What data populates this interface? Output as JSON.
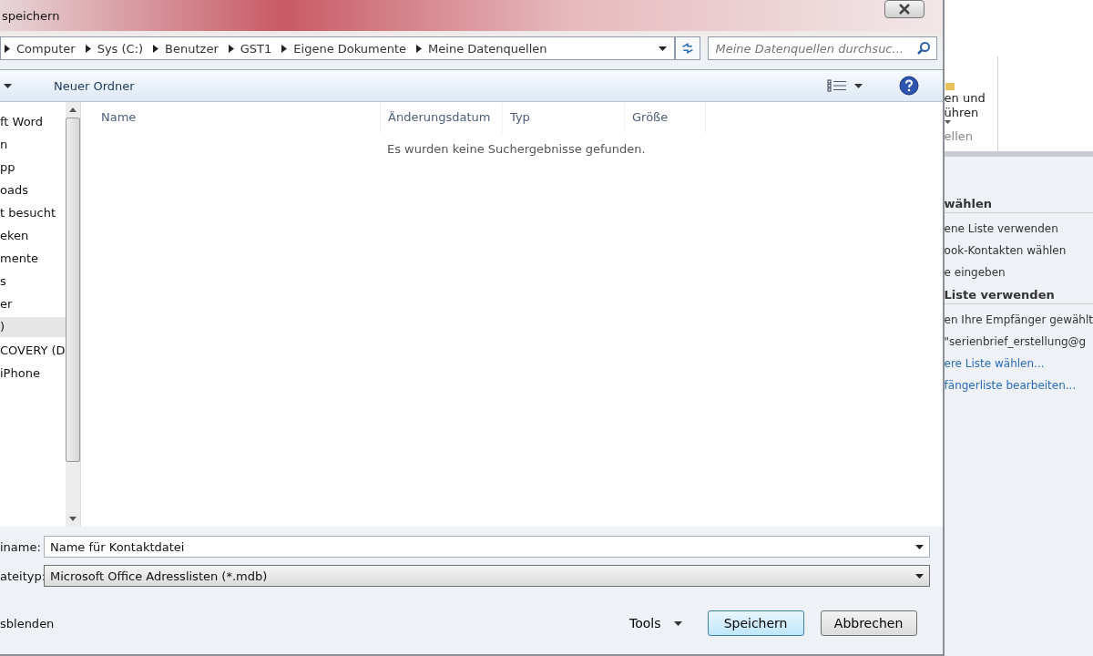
{
  "dialog": {
    "title": "speichern",
    "breadcrumb": [
      "Computer",
      "Sys (C:)",
      "Benutzer",
      "GST1",
      "Eigene Dokumente",
      "Meine Datenquellen"
    ],
    "search": {
      "placeholder": "Meine Datenquellen durchsuc..."
    },
    "toolbar": {
      "new_folder": "Neuer Ordner"
    },
    "nav_items": [
      {
        "label": "ft Word",
        "selected": false
      },
      {
        "label": "n",
        "selected": false
      },
      {
        "label": "pp",
        "selected": false
      },
      {
        "label": "oads",
        "selected": false
      },
      {
        "label": "t besucht",
        "selected": false
      },
      {
        "label": "eken",
        "selected": false
      },
      {
        "label": "mente",
        "selected": false
      },
      {
        "label": "s",
        "selected": false
      },
      {
        "label": "er",
        "selected": false
      },
      {
        "label": ")",
        "selected": true
      },
      {
        "label": "COVERY (D",
        "selected": false
      },
      {
        "label": "iPhone",
        "selected": false
      }
    ],
    "columns": [
      "Name",
      "Änderungsdatum",
      "Typ",
      "Größe"
    ],
    "empty_message": "Es wurden keine Suchergebnisse gefunden.",
    "filename": {
      "label": "iname:",
      "value": "Name für Kontaktdatei"
    },
    "filetype": {
      "label": "ateityp:",
      "value": "Microsoft Office Adresslisten (*.mdb)"
    },
    "hide_folders": "sblenden",
    "tools": "Tools",
    "buttons": [
      {
        "label": "Speichern",
        "default": true
      },
      {
        "label": "Abbrechen",
        "default": false
      }
    ]
  },
  "background": {
    "ribbon": [
      "en und",
      "ühren"
    ],
    "ribbon_group": "ellen",
    "pane": [
      {
        "kind": "heading",
        "text": "wählen"
      },
      {
        "kind": "option",
        "text": "ene Liste verwenden"
      },
      {
        "kind": "option",
        "text": "ook-Kontakten wählen"
      },
      {
        "kind": "option",
        "text": "e eingeben"
      },
      {
        "kind": "heading",
        "text": "Liste verwenden"
      },
      {
        "kind": "text",
        "text": "en Ihre Empfänger gewählt"
      },
      {
        "kind": "text",
        "text": "\"serienbrief_erstellung@g"
      },
      {
        "kind": "link",
        "text": "ere Liste wählen..."
      },
      {
        "kind": "link",
        "text": "fängerliste bearbeiten..."
      }
    ]
  }
}
